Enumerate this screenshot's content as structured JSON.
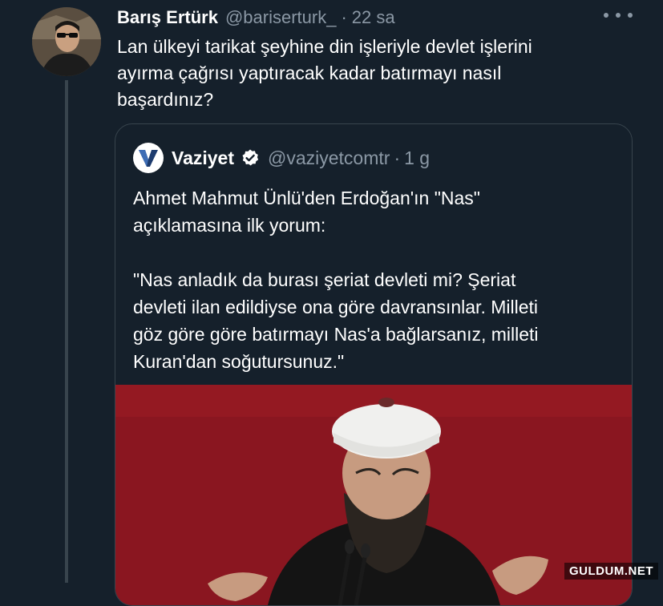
{
  "tweet": {
    "author_name": "Barış Ertürk",
    "author_handle": "@bariserturk_",
    "separator": "·",
    "time": "22 sa",
    "text": "Lan ülkeyi tarikat şeyhine din işleriyle devlet işlerini\nayırma çağrısı yaptıracak kadar batırmayı nasıl\nbaşardınız?"
  },
  "quoted_tweet": {
    "author_name": "Vaziyet",
    "verified": true,
    "author_handle": "@vaziyetcomtr",
    "separator": "·",
    "time": "1 g",
    "text": "Ahmet Mahmut Ünlü'den Erdoğan'ın \"Nas\"\naçıklamasına ilk yorum:\n\n\"Nas anladık da burası şeriat devleti mi? Şeriat\ndevleti ilan edildiyse ona göre davransınlar. Milleti\ngöz göre göre batırmayı Nas'a bağlarsanız, milleti\nKuran'dan soğutursunuz.\""
  },
  "watermark": "GULDUM.NET",
  "icons": {
    "more": "more-horizontal-icon",
    "verified": "verified-badge-icon",
    "brand_logo": "vaziyet-logo"
  },
  "colors": {
    "background": "#15202b",
    "text": "#ffffff",
    "secondary_text": "#8b98a5",
    "border": "#38444d",
    "brand": "#1d3b6e",
    "image_backdrop": "#8e1820"
  }
}
